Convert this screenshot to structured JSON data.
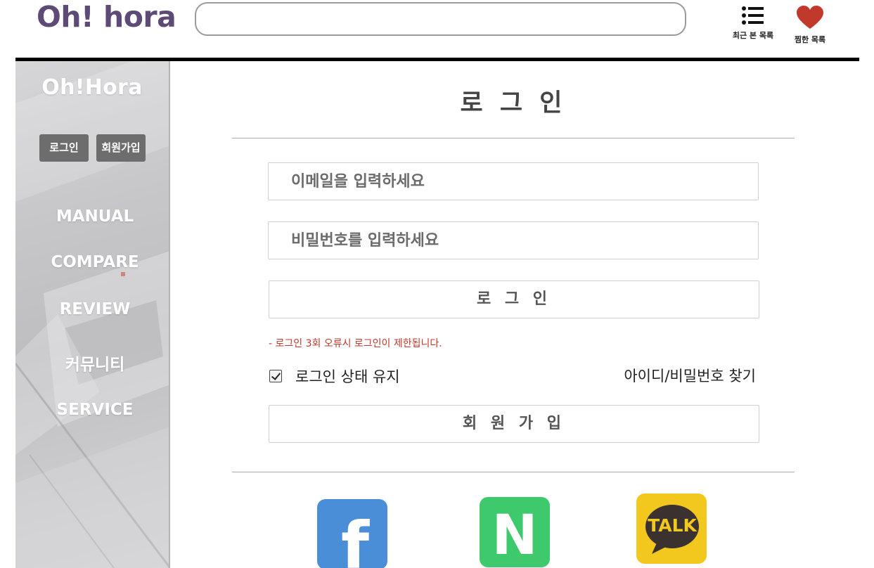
{
  "header": {
    "logo": "Oh! hora",
    "search_placeholder": "",
    "recent_label": "최근 본 목록",
    "liked_label": "찜한 목록"
  },
  "sidebar": {
    "title": "Oh!Hora",
    "login_button": "로그인",
    "signup_button": "회원가입",
    "nav": [
      "MANUAL",
      "COMPARE",
      "REVIEW",
      "커뮤니티",
      "SERVICE"
    ]
  },
  "main": {
    "title": "로 그 인",
    "email_placeholder": "이메일을 입력하세요",
    "password_placeholder": "비밀번호를 입력하세요",
    "login_button": "로 그 인",
    "warning": "- 로그인 3회 오류시 로그인이 제한됩니다.",
    "keep_login_label": "로그인 상태 유지",
    "keep_login_checked": true,
    "find_account_link": "아이디/비밀번호 찾기",
    "signup_button": "회 원 가 입"
  },
  "social": {
    "facebook_letter": "f",
    "naver_letter": "N",
    "kakao_text": "TALK"
  },
  "colors": {
    "logo": "#5e4a76",
    "heart": "#c0392b",
    "warning": "#c0392b",
    "facebook": "#4a8ed8",
    "naver": "#3ec96c",
    "kakao": "#f2c81e"
  }
}
